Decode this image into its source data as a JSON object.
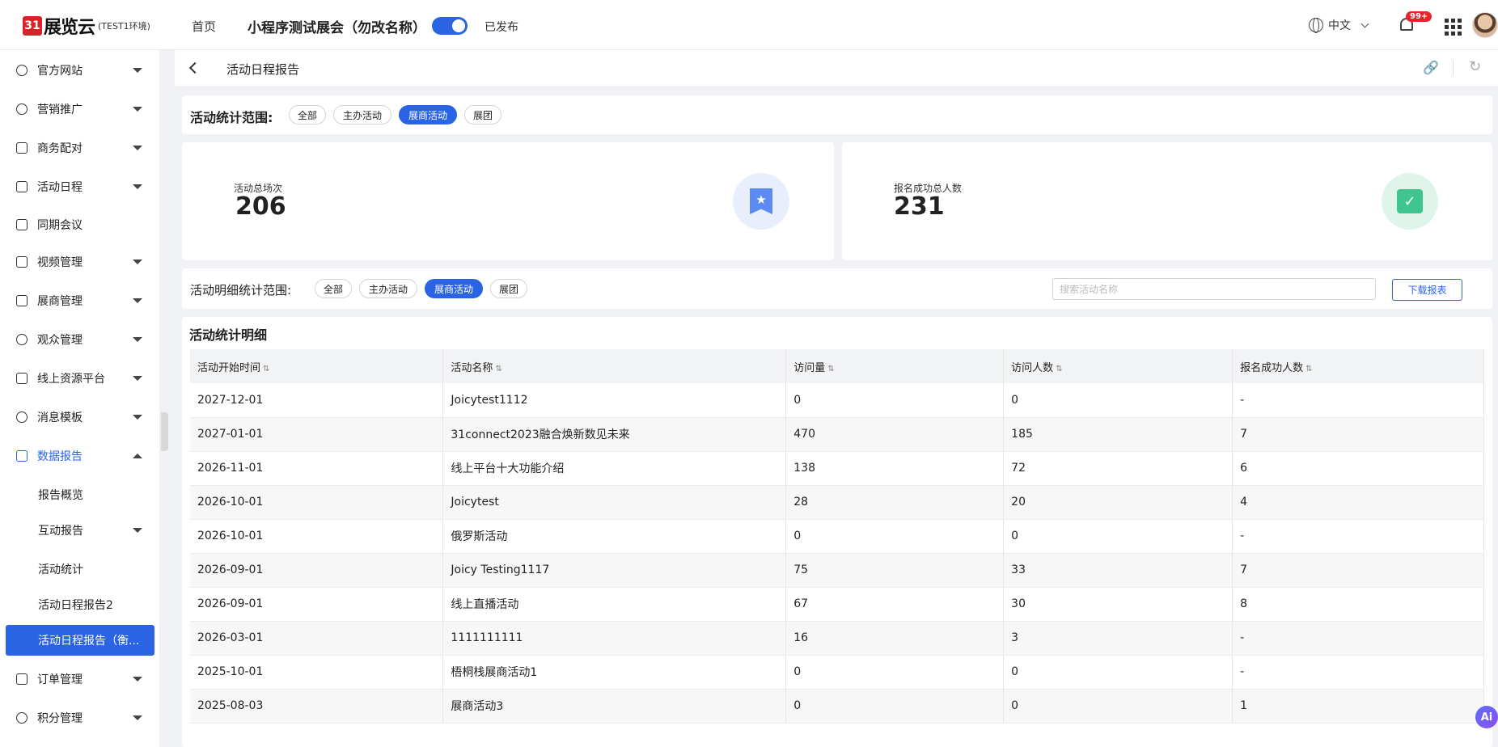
{
  "header": {
    "logo_mark": "31",
    "logo_text": "展览云",
    "logo_env": "(TEST1环境)",
    "nav_home": "首页",
    "expo_title": "小程序测试展会（勿改名称）",
    "published_label": "已发布",
    "language": "中文",
    "notification_badge": "99+"
  },
  "sidebar": {
    "items": [
      {
        "label": "官方网站"
      },
      {
        "label": "营销推广"
      },
      {
        "label": "商务配对"
      },
      {
        "label": "活动日程"
      },
      {
        "label": "同期会议"
      },
      {
        "label": "视频管理"
      },
      {
        "label": "展商管理"
      },
      {
        "label": "观众管理"
      },
      {
        "label": "线上资源平台"
      },
      {
        "label": "消息模板"
      },
      {
        "label": "数据报告"
      },
      {
        "label": "订单管理"
      },
      {
        "label": "积分管理"
      }
    ],
    "sub_items": [
      {
        "label": "报告概览"
      },
      {
        "label": "互动报告"
      },
      {
        "label": "活动统计"
      },
      {
        "label": "活动日程报告2"
      },
      {
        "label": "活动日程报告（衡..."
      }
    ]
  },
  "page": {
    "title": "活动日程报告"
  },
  "scope": {
    "label": "活动统计范围:",
    "pills": [
      "全部",
      "主办活动",
      "展商活动",
      "展团"
    ],
    "active": "展商活动"
  },
  "stats": {
    "total_sessions_label": "活动总场次",
    "total_sessions_value": "206",
    "registered_label": "报名成功总人数",
    "registered_value": "231"
  },
  "detail_scope": {
    "label": "活动明细统计范围:",
    "pills": [
      "全部",
      "主办活动",
      "展商活动",
      "展团"
    ],
    "active": "展商活动",
    "search_placeholder": "搜索活动名称",
    "download_label": "下载报表"
  },
  "table": {
    "title": "活动统计明细",
    "columns": [
      "活动开始时间",
      "活动名称",
      "访问量",
      "访问人数",
      "报名成功人数"
    ],
    "rows": [
      [
        "2027-12-01",
        "Joicytest1112",
        "0",
        "0",
        "-"
      ],
      [
        "2027-01-01",
        "31connect2023融合焕新数见未来",
        "470",
        "185",
        "7"
      ],
      [
        "2026-11-01",
        "线上平台十大功能介绍",
        "138",
        "72",
        "6"
      ],
      [
        "2026-10-01",
        "Joicytest",
        "28",
        "20",
        "4"
      ],
      [
        "2026-10-01",
        "俄罗斯活动",
        "0",
        "0",
        "-"
      ],
      [
        "2026-09-01",
        "Joicy Testing1117",
        "75",
        "33",
        "7"
      ],
      [
        "2026-09-01",
        "线上直播活动",
        "67",
        "30",
        "8"
      ],
      [
        "2026-03-01",
        "1111111111",
        "16",
        "3",
        "-"
      ],
      [
        "2025-10-01",
        "梧桐栈展商活动1",
        "0",
        "0",
        "-"
      ],
      [
        "2025-08-03",
        "展商活动3",
        "0",
        "0",
        "1"
      ]
    ]
  },
  "colors": {
    "primary": "#2b64e3",
    "badge": "#e5242b"
  },
  "ai_label": "Ai"
}
